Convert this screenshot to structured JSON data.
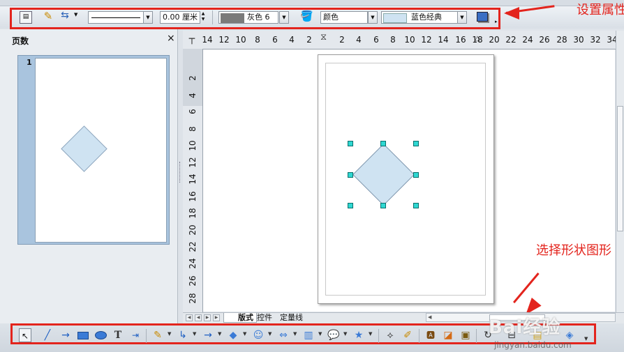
{
  "properties_toolbar": {
    "line_width_value": "0.00 厘米",
    "line_color_label": "灰色 6",
    "area_style_label": "颜色",
    "area_fill_label": "蓝色经典"
  },
  "pages_panel": {
    "title": "页数",
    "close": "×",
    "page_number": "1"
  },
  "ruler": {
    "horizontal": [
      "14",
      "12",
      "10",
      "8",
      "6",
      "4",
      "2",
      "2",
      "4",
      "6",
      "8",
      "10",
      "12",
      "14",
      "16",
      "18",
      "20",
      "22",
      "24",
      "26",
      "28",
      "30",
      "32",
      "34"
    ],
    "vertical": [
      "2",
      "4",
      "6",
      "8",
      "10",
      "12",
      "14",
      "16",
      "18",
      "20",
      "22",
      "24",
      "26",
      "28"
    ]
  },
  "tabs": [
    "版式",
    "控件",
    "定量线"
  ],
  "annotations": {
    "set_properties": "设置属性",
    "choose_shape": "选择形状图形"
  },
  "colors": {
    "accent_red": "#e3241d",
    "shape_fill": "#cfe3f2",
    "handle": "#2fd8d2",
    "thumb_selected": "#a9c4de"
  },
  "watermark": {
    "brand": "Bai经验",
    "url": "jingyan.baidu.com"
  },
  "icons": {
    "draw_toolbar": [
      "select-arrow-icon",
      "line-icon",
      "arrow-line-icon",
      "rectangle-icon",
      "ellipse-icon",
      "text-icon",
      "connector-icon",
      "freeform-icon",
      "connectors-icon",
      "lines-arrows-icon",
      "basic-shapes-icon",
      "symbol-shapes-icon",
      "block-arrows-icon",
      "flowchart-icon",
      "callouts-icon",
      "stars-icon",
      "points-icon",
      "glue-icon",
      "fontwork-icon",
      "image-icon",
      "shapes-3d-icon",
      "rotate-icon",
      "align-icon",
      "arrange-icon",
      "extrusion-icon"
    ]
  }
}
